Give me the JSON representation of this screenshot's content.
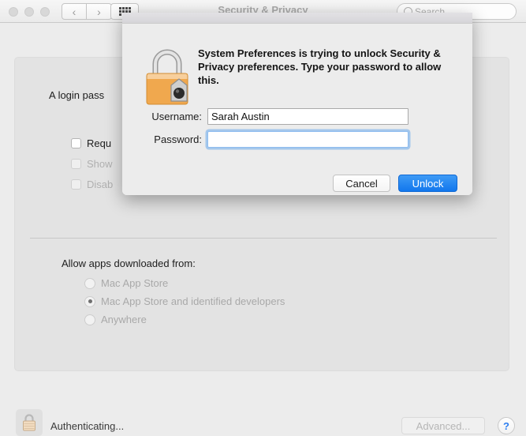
{
  "window": {
    "title": "Security & Privacy",
    "search_placeholder": "Search"
  },
  "toolbar": {
    "back_glyph": "‹",
    "forward_glyph": "›"
  },
  "general_pane": {
    "login_password_text": "A login pass",
    "checkboxes": [
      {
        "label": "Requ",
        "checked": false,
        "enabled": true
      },
      {
        "label": "Show",
        "checked": false,
        "enabled": false
      },
      {
        "label": "Disab",
        "checked": false,
        "enabled": false
      }
    ]
  },
  "gatekeeper": {
    "label": "Allow apps downloaded from:",
    "options": [
      {
        "label": "Mac App Store",
        "selected": false
      },
      {
        "label": "Mac App Store and identified developers",
        "selected": true
      },
      {
        "label": "Anywhere",
        "selected": false
      }
    ]
  },
  "bottom_bar": {
    "status_text": "Authenticating...",
    "advanced_label": "Advanced...",
    "help_label": "?"
  },
  "auth_sheet": {
    "message": "System Preferences is trying to unlock Security & Privacy preferences. Type your password to allow this.",
    "username_label": "Username:",
    "username_value": "Sarah Austin",
    "password_label": "Password:",
    "password_value": "",
    "cancel_label": "Cancel",
    "unlock_label": "Unlock"
  },
  "colors": {
    "accent_blue": "#1277ed",
    "focus_ring": "#69aaeb",
    "lock_orange": "#f0a84e",
    "help_blue": "#2d7ff0"
  }
}
